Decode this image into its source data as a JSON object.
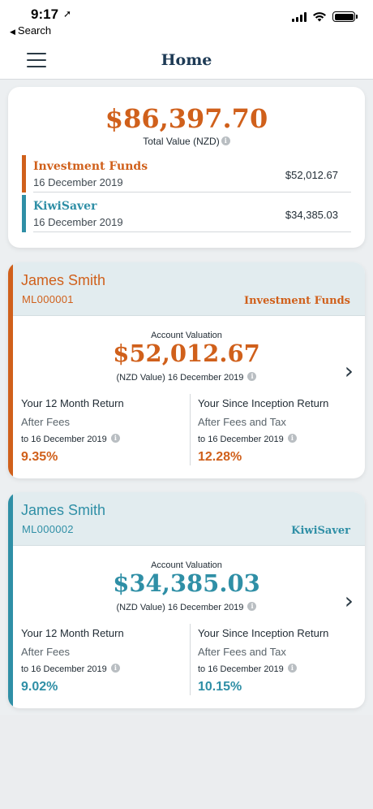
{
  "status_bar": {
    "time": "9:17",
    "back_label": "Search"
  },
  "nav": {
    "title": "Home",
    "menu_icon": "hamburger-menu-icon"
  },
  "summary": {
    "total_value": "$86,397.70",
    "total_label": "Total Value (NZD)",
    "rows": [
      {
        "name": "Investment Funds",
        "date": "16 December 2019",
        "amount": "$52,012.67",
        "color": "#d0601b"
      },
      {
        "name": "KiwiSaver",
        "date": "16 December 2019",
        "amount": "$34,385.03",
        "color": "#2f8fa6"
      }
    ]
  },
  "accounts": [
    {
      "holder": "James Smith",
      "code": "ML000001",
      "type": "Investment Funds",
      "accent_color": "#d0601b",
      "valuation_label": "Account Valuation",
      "valuation": "$52,012.67",
      "valuation_sub": "(NZD Value) 16 December 2019",
      "return_12m": {
        "title": "Your 12 Month Return",
        "fees": "After Fees",
        "to": "to 16 December 2019",
        "value": "9.35%"
      },
      "return_inception": {
        "title": "Your Since Inception Return",
        "fees": "After Fees and Tax",
        "to": "to 16 December 2019",
        "value": "12.28%"
      }
    },
    {
      "holder": "James Smith",
      "code": "ML000002",
      "type": "KiwiSaver",
      "accent_color": "#2f8fa6",
      "valuation_label": "Account Valuation",
      "valuation": "$34,385.03",
      "valuation_sub": "(NZD Value) 16 December 2019",
      "return_12m": {
        "title": "Your 12 Month Return",
        "fees": "After Fees",
        "to": "to 16 December 2019",
        "value": "9.02%"
      },
      "return_inception": {
        "title": "Your Since Inception Return",
        "fees": "After Fees and Tax",
        "to": "to 16 December 2019",
        "value": "10.15%"
      }
    }
  ]
}
